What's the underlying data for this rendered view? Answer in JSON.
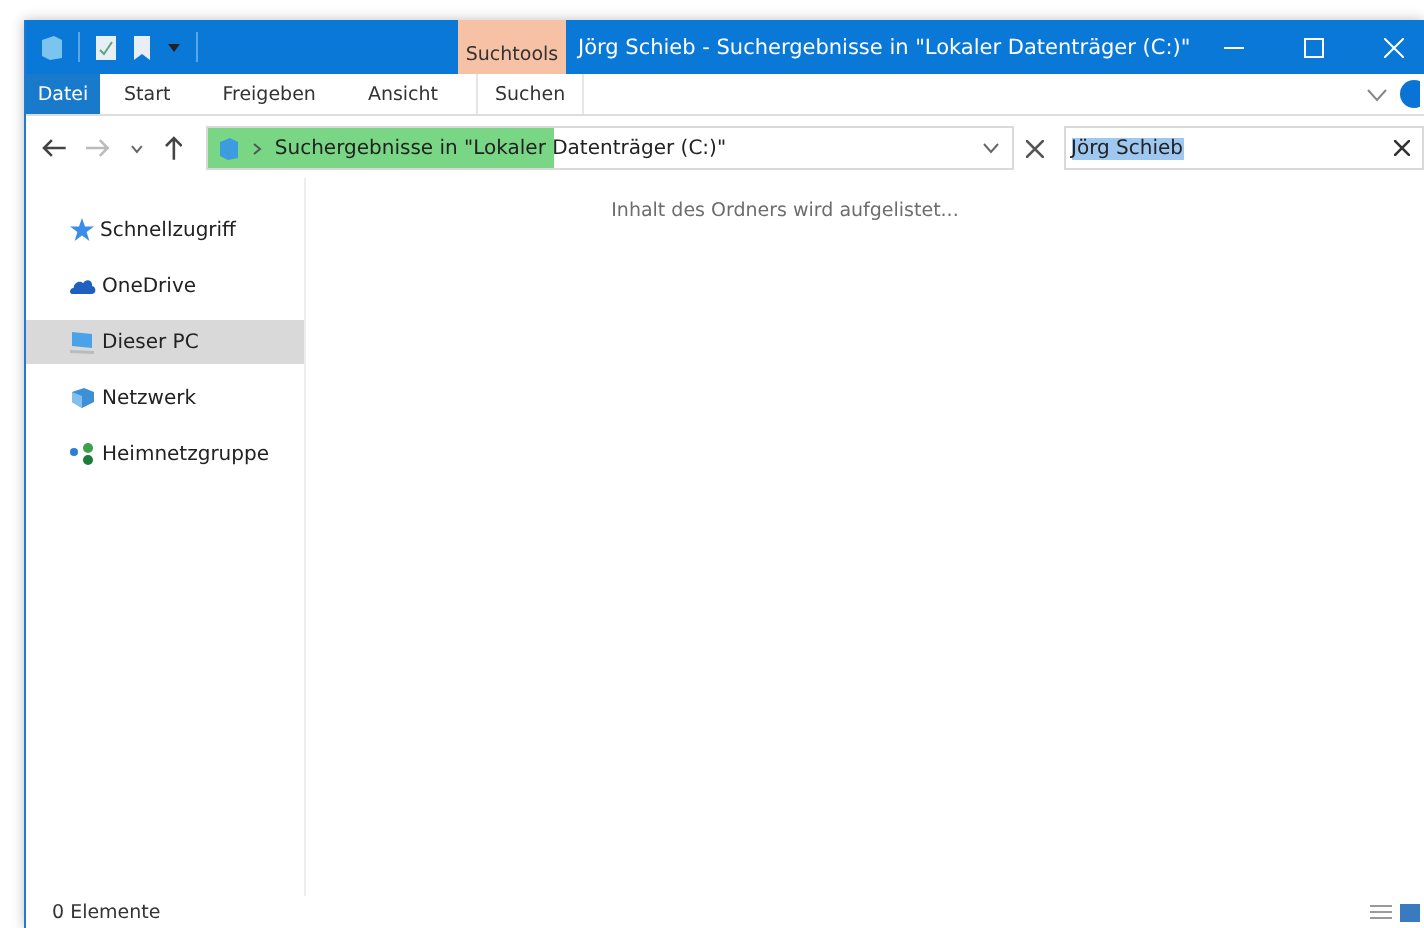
{
  "window": {
    "title": "Jörg Schieb - Suchergebnisse in \"Lokaler Datenträger (C:)\"",
    "context_tab": "Suchtools"
  },
  "ribbon_tabs": [
    {
      "label": "Datei",
      "kind": "file",
      "selected": false
    },
    {
      "label": "Start",
      "kind": "tab",
      "selected": false
    },
    {
      "label": "Freigeben",
      "kind": "tab",
      "selected": false
    },
    {
      "label": "Ansicht",
      "kind": "tab",
      "selected": false
    },
    {
      "label": "Suchen",
      "kind": "context",
      "selected": true
    }
  ],
  "address_bar": {
    "path": "Suchergebnisse in \"Lokaler Datenträger (C:)\"",
    "level": 0.43
  },
  "search": {
    "value": "Jörg Schieb"
  },
  "sidebar": {
    "items": [
      {
        "label": "Schnellzugriff",
        "kind": "star",
        "selected": false
      },
      {
        "label": "OneDrive",
        "kind": "cloud",
        "selected": false
      },
      {
        "label": "Dieser PC",
        "kind": "pc",
        "selected": true
      },
      {
        "label": "Netzwerk",
        "kind": "network",
        "selected": false
      },
      {
        "label": "Heimnetzgruppe",
        "kind": "homegroup",
        "selected": false
      }
    ]
  },
  "content": {
    "message": "Inhalt des Ordners wird aufgelistet..."
  },
  "status_bar": {
    "count": "0 Elemente"
  }
}
